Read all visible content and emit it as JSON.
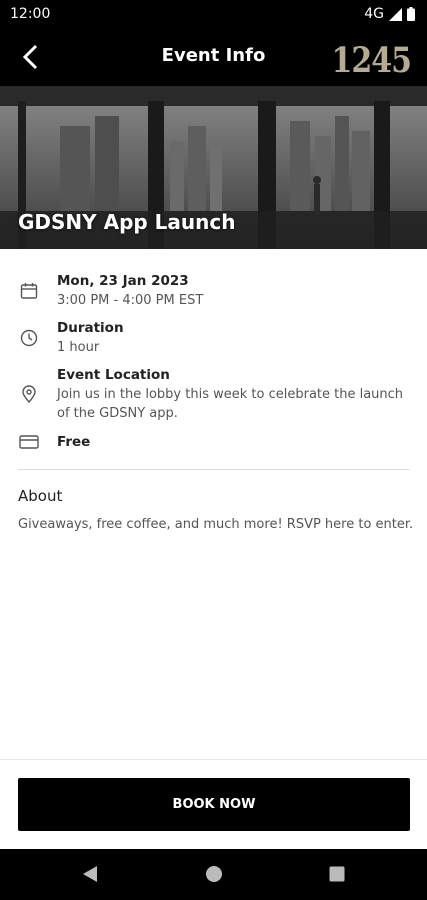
{
  "status_bar": {
    "time": "12:00",
    "network": "4G"
  },
  "header": {
    "title": "Event Info",
    "brand": "1245"
  },
  "hero": {
    "event_title": "GDSNY App Launch"
  },
  "details": {
    "date": "Mon, 23 Jan 2023",
    "time_range": "3:00 PM - 4:00 PM EST",
    "duration_label": "Duration",
    "duration_value": "1 hour",
    "location_label": "Event Location",
    "location_value": "Join us in the lobby this week to celebrate the launch of the GDSNY app.",
    "price": "Free"
  },
  "about": {
    "title": "About",
    "body": "Giveaways, free coffee, and much more! RSVP here to enter."
  },
  "footer": {
    "book_label": "BOOK NOW"
  },
  "colors": {
    "primary": "#000000",
    "brand": "#b5ab93",
    "background": "#ffffff"
  },
  "icons": [
    "calendar-icon",
    "clock-icon",
    "location-pin-icon",
    "credit-card-icon"
  ]
}
